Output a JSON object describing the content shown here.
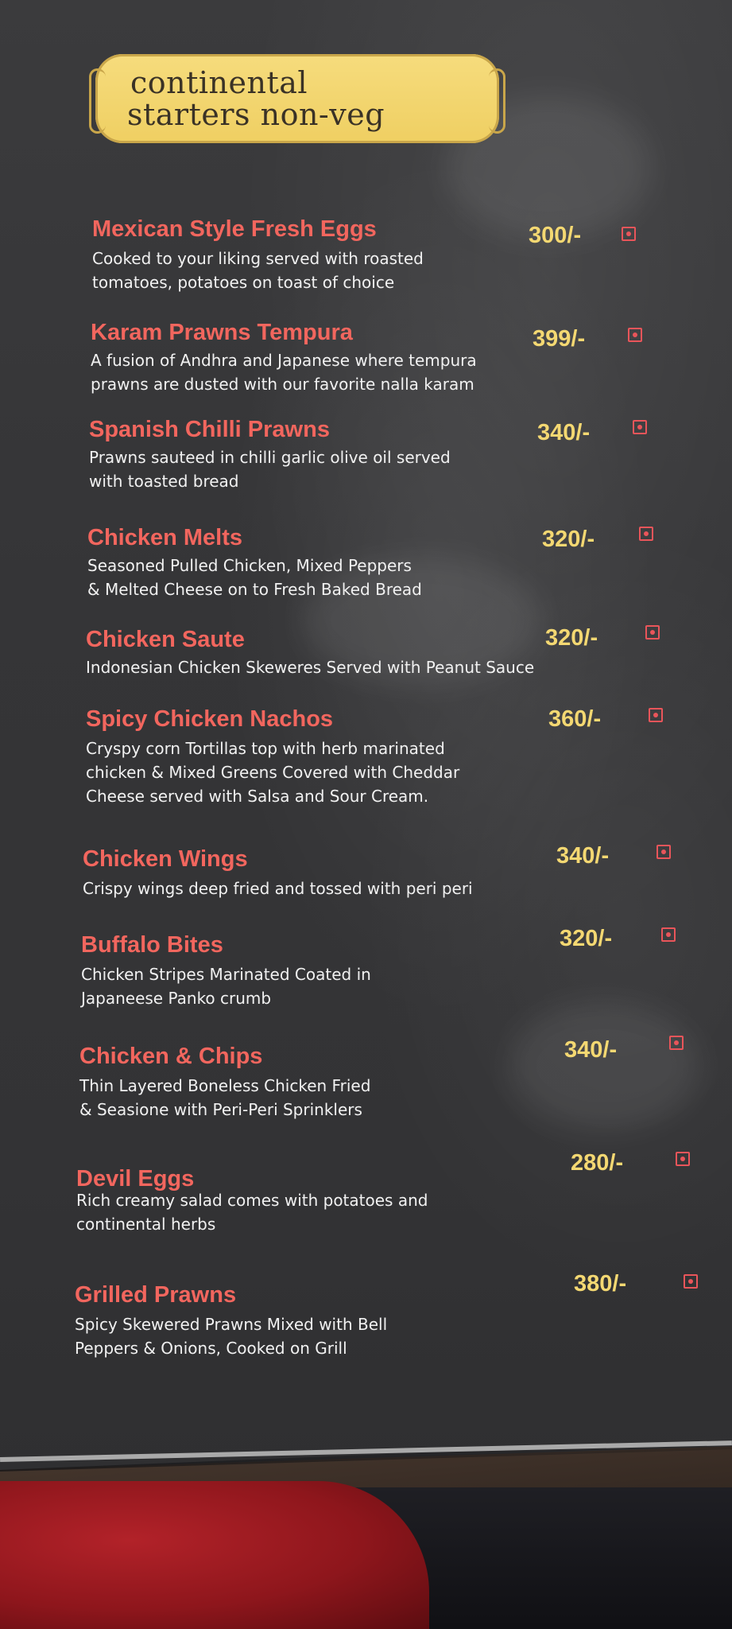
{
  "header": {
    "line1": "continental",
    "line2": "starters non-veg"
  },
  "colors": {
    "board": "#353537",
    "plaque": "#f2d56d",
    "item_name": "#f2665e",
    "price": "#f4d872",
    "description": "#f1f1f1"
  },
  "items": [
    {
      "name": "Mexican Style Fresh Eggs",
      "price": "300/-",
      "desc": "Cooked to your liking served with roasted\ntomatoes, potatoes on toast of choice",
      "icon": "non-veg-icon"
    },
    {
      "name": "Karam Prawns Tempura",
      "price": "399/-",
      "desc": "A fusion of Andhra and Japanese where tempura\nprawns are dusted with our favorite nalla karam",
      "icon": "non-veg-icon"
    },
    {
      "name": "Spanish Chilli Prawns",
      "price": "340/-",
      "desc": "Prawns sauteed in chilli garlic olive oil served\nwith toasted bread",
      "icon": "non-veg-icon"
    },
    {
      "name": "Chicken Melts",
      "price": "320/-",
      "desc": "Seasoned Pulled Chicken, Mixed Peppers\n& Melted Cheese on to Fresh Baked Bread",
      "icon": "non-veg-icon"
    },
    {
      "name": "Chicken Saute",
      "price": "320/-",
      "desc": "Indonesian Chicken Skeweres Served with Peanut Sauce",
      "icon": "non-veg-icon"
    },
    {
      "name": "Spicy Chicken Nachos",
      "price": "360/-",
      "desc": "Cryspy corn Tortillas top with herb marinated\nchicken & Mixed Greens Covered with Cheddar\nCheese served with Salsa and Sour Cream.",
      "icon": "non-veg-icon"
    },
    {
      "name": "Chicken Wings",
      "price": "340/-",
      "desc": "Crispy wings deep fried and tossed with peri peri",
      "icon": "non-veg-icon"
    },
    {
      "name": "Buffalo Bites",
      "price": "320/-",
      "desc": "Chicken Stripes Marinated Coated in\nJapaneese Panko crumb",
      "icon": "non-veg-icon"
    },
    {
      "name": "Chicken & Chips",
      "price": "340/-",
      "desc": "Thin Layered Boneless Chicken Fried\n& Seasione with Peri-Peri Sprinklers",
      "icon": "non-veg-icon"
    },
    {
      "name": "Devil Eggs",
      "price": "280/-",
      "desc": "Rich creamy salad comes with potatoes and\ncontinental herbs",
      "icon": "non-veg-icon"
    },
    {
      "name": "Grilled Prawns",
      "price": "380/-",
      "desc": "Spicy Skewered Prawns Mixed with Bell\nPeppers & Onions, Cooked on Grill",
      "icon": "non-veg-icon"
    }
  ]
}
